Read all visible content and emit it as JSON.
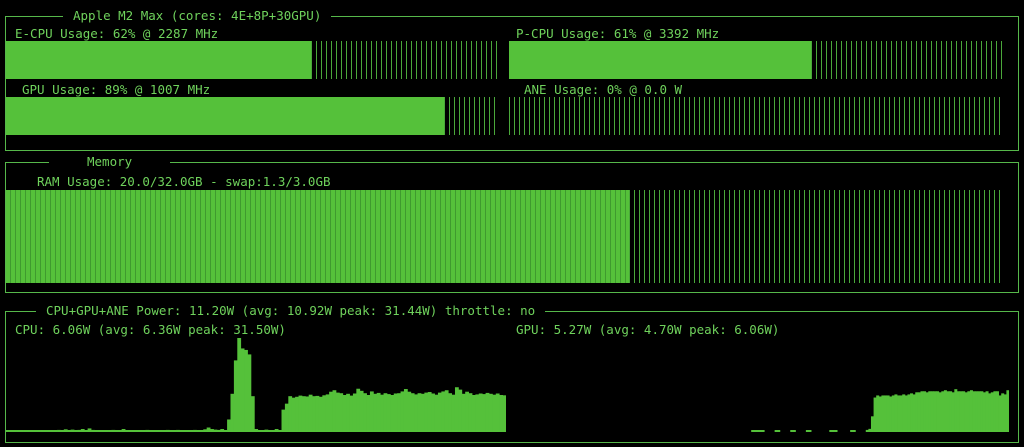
{
  "colors": {
    "background": "#000000",
    "text": "#6fd25c",
    "border": "#56b84a",
    "bar_fill": "#55c13a",
    "bar_empty": "#4aa83a"
  },
  "processor_panel": {
    "title": "Apple M2 Max (cores: 4E+8P+30GPU)",
    "gauges": [
      {
        "id": "ecpu",
        "label": "E-CPU Usage: 62% @ 2287 MHz",
        "percent": 62
      },
      {
        "id": "pcpu",
        "label": "P-CPU Usage: 61% @ 3392 MHz",
        "percent": 61
      },
      {
        "id": "gpu",
        "label": "GPU Usage: 89% @ 1007 MHz",
        "percent": 89
      },
      {
        "id": "ane",
        "label": "ANE Usage: 0% @ 0.0 W",
        "percent": 0
      }
    ]
  },
  "memory_panel": {
    "title": "Memory",
    "ram_label": "RAM Usage: 20.0/32.0GB - swap:1.3/3.0GB",
    "ram_percent": 62.5
  },
  "power_panel": {
    "title": "CPU+GPU+ANE Power: 11.20W (avg: 10.92W peak: 31.44W) throttle: no",
    "cpu_label": "CPU: 6.06W (avg: 6.36W peak: 31.50W)",
    "gpu_label": "GPU: 5.27W (avg: 4.70W peak: 6.06W)",
    "cpu_history_w": [
      0.3,
      0.4,
      0.3,
      0.3,
      0.4,
      0.3,
      0.5,
      0.4,
      0.3,
      0.6,
      0.4,
      0.5,
      0.3,
      0.4,
      0.5,
      0.7,
      0.6,
      0.9,
      0.5,
      0.8,
      0.6,
      0.7,
      1.0,
      0.5,
      1.2,
      0.7,
      0.6,
      0.5,
      0.4,
      0.6,
      0.4,
      0.7,
      0.5,
      0.5,
      1.0,
      0.5,
      0.6,
      0.5,
      0.4,
      0.6,
      0.5,
      0.7,
      0.6,
      0.5,
      0.4,
      0.6,
      0.5,
      0.7,
      0.6,
      0.5,
      0.7,
      0.6,
      0.5,
      0.5,
      0.6,
      0.7,
      0.5,
      0.6,
      0.9,
      1.5,
      1.0,
      0.8,
      0.7,
      1.0,
      0.6,
      4.2,
      12.8,
      24.0,
      31.5,
      28.0,
      27.5,
      26.0,
      12.0,
      1.0,
      0.5,
      0.4,
      0.8,
      0.6,
      0.4,
      1.0,
      0.5,
      7.5,
      9.5,
      12.0,
      11.5,
      11.8,
      12.2,
      12.0,
      11.9,
      12.5,
      12.0,
      12.1,
      11.8,
      12.3,
      12.6,
      13.5,
      14.0,
      13.2,
      13.0,
      12.4,
      12.8,
      12.2,
      12.9,
      14.5,
      13.8,
      13.0,
      12.4,
      13.6,
      12.8,
      13.1,
      12.5,
      13.0,
      12.7,
      12.4,
      12.9,
      13.0,
      13.6,
      14.4,
      13.5,
      13.0,
      12.6,
      13.0,
      12.8,
      13.2,
      13.4,
      12.9,
      12.5,
      13.2,
      13.6,
      14.0,
      13.0,
      12.5,
      15.0,
      14.2,
      12.8,
      13.5,
      13.0,
      12.4,
      12.6,
      12.9,
      12.7,
      13.1,
      12.8,
      12.5,
      12.9,
      12.4,
      12.3
    ],
    "gpu_history_w": [
      0,
      0,
      0,
      0,
      0,
      0,
      0,
      0,
      0,
      0,
      0,
      0,
      0,
      0,
      0,
      0,
      0,
      0,
      0,
      0,
      0,
      0,
      0,
      0,
      0,
      0,
      0,
      0,
      0,
      0,
      0,
      0,
      0,
      0,
      0,
      0,
      0,
      0,
      0,
      0,
      0,
      0,
      0,
      0,
      0,
      0,
      0,
      0,
      0,
      0,
      0,
      0,
      0,
      0,
      0,
      0,
      0,
      0,
      0,
      0,
      0,
      0,
      0,
      0,
      0,
      0,
      0,
      0,
      0,
      0,
      0,
      0,
      0,
      0,
      0,
      0,
      0,
      0,
      0,
      0,
      0,
      0,
      0,
      0,
      0,
      0,
      0,
      0,
      0,
      0,
      0,
      0,
      0,
      0.15,
      0.15,
      0.15,
      0.15,
      0.15,
      0,
      0,
      0,
      0,
      0.15,
      0.15,
      0,
      0,
      0,
      0,
      0.15,
      0.15,
      0,
      0,
      0,
      0,
      0.15,
      0.15,
      0,
      0,
      0,
      0,
      0,
      0,
      0,
      0.15,
      0.15,
      0.15,
      0,
      0,
      0,
      0,
      0,
      0.15,
      0.15,
      0,
      0,
      0,
      0,
      0.2,
      0.3,
      1.5,
      3.3,
      3.5,
      3.4,
      3.5,
      3.5,
      3.5,
      3.4,
      3.5,
      3.6,
      3.5,
      3.5,
      3.6,
      3.5,
      3.6,
      3.7,
      3.6,
      3.8,
      3.8,
      3.9,
      3.9,
      3.8,
      3.9,
      3.9,
      3.9,
      3.9,
      3.8,
      3.9,
      4.0,
      3.9,
      3.9,
      3.8,
      4.1,
      3.9,
      3.9,
      3.9,
      3.8,
      3.9,
      4.0,
      3.9,
      3.9,
      3.9,
      3.9,
      3.8,
      3.9,
      3.7,
      3.8,
      3.9,
      3.9,
      3.5,
      3.7,
      3.6,
      4.0
    ]
  }
}
